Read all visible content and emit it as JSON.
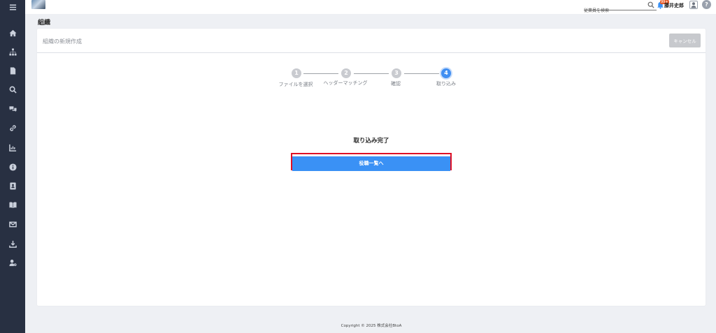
{
  "sidebar": {
    "items": [
      {
        "icon": "hamburger-menu-icon"
      },
      {
        "icon": "home-icon"
      },
      {
        "icon": "org-chart-icon"
      },
      {
        "icon": "document-icon"
      },
      {
        "icon": "search-icon"
      },
      {
        "icon": "chat-icon"
      },
      {
        "icon": "link-icon"
      },
      {
        "icon": "chart-icon"
      },
      {
        "icon": "info-icon"
      },
      {
        "icon": "contact-book-icon"
      },
      {
        "icon": "book-icon"
      },
      {
        "icon": "mail-icon"
      },
      {
        "icon": "download-icon"
      },
      {
        "icon": "user-settings-icon"
      }
    ]
  },
  "header": {
    "search_placeholder": "従業員を検索",
    "notification_count": "99+",
    "user_name": "藤井史郎",
    "help_label": "?"
  },
  "page": {
    "title": "組織"
  },
  "card": {
    "title": "組織の新規作成",
    "cancel_label": "キャンセル"
  },
  "stepper": {
    "steps": [
      {
        "number": "1",
        "label": "ファイルを選択",
        "active": false
      },
      {
        "number": "2",
        "label": "ヘッダーマッチング",
        "active": false
      },
      {
        "number": "3",
        "label": "確認",
        "active": false
      },
      {
        "number": "4",
        "label": "取り込み",
        "active": true
      }
    ]
  },
  "result": {
    "message": "取り込み完了",
    "button_label": "役職一覧へ"
  },
  "footer": {
    "copyright": "Copyright © 2025 株式会社BtoA"
  },
  "colors": {
    "sidebar_bg": "#283042",
    "primary": "#3a91f5",
    "highlight_border": "#e01025",
    "badge": "#e55c2b"
  }
}
